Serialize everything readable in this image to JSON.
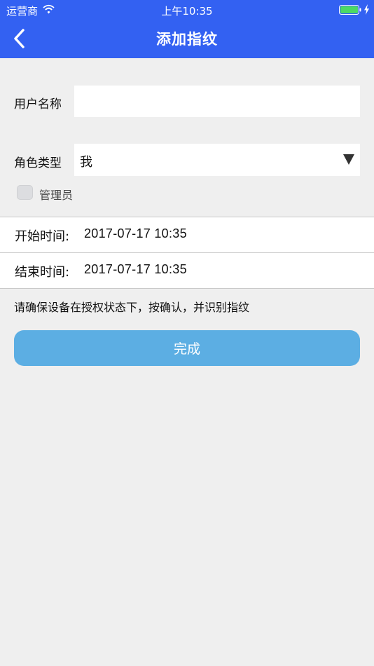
{
  "status_bar": {
    "carrier": "运营商",
    "time": "上午10:35"
  },
  "header": {
    "title": "添加指纹",
    "background_color": "#3361f2"
  },
  "form": {
    "username_label": "用户名称",
    "username_value": "",
    "role_label": "角色类型",
    "role_value": "我",
    "admin_label": "管理员",
    "admin_checked": false
  },
  "times": {
    "start_label": "开始时间:",
    "start_value": "2017-07-17 10:35",
    "end_label": "结束时间:",
    "end_value": "2017-07-17 10:35"
  },
  "hint": "请确保设备在授权状态下，按确认，并识别指纹",
  "done_button": {
    "label": "完成",
    "color": "#5caee3"
  }
}
